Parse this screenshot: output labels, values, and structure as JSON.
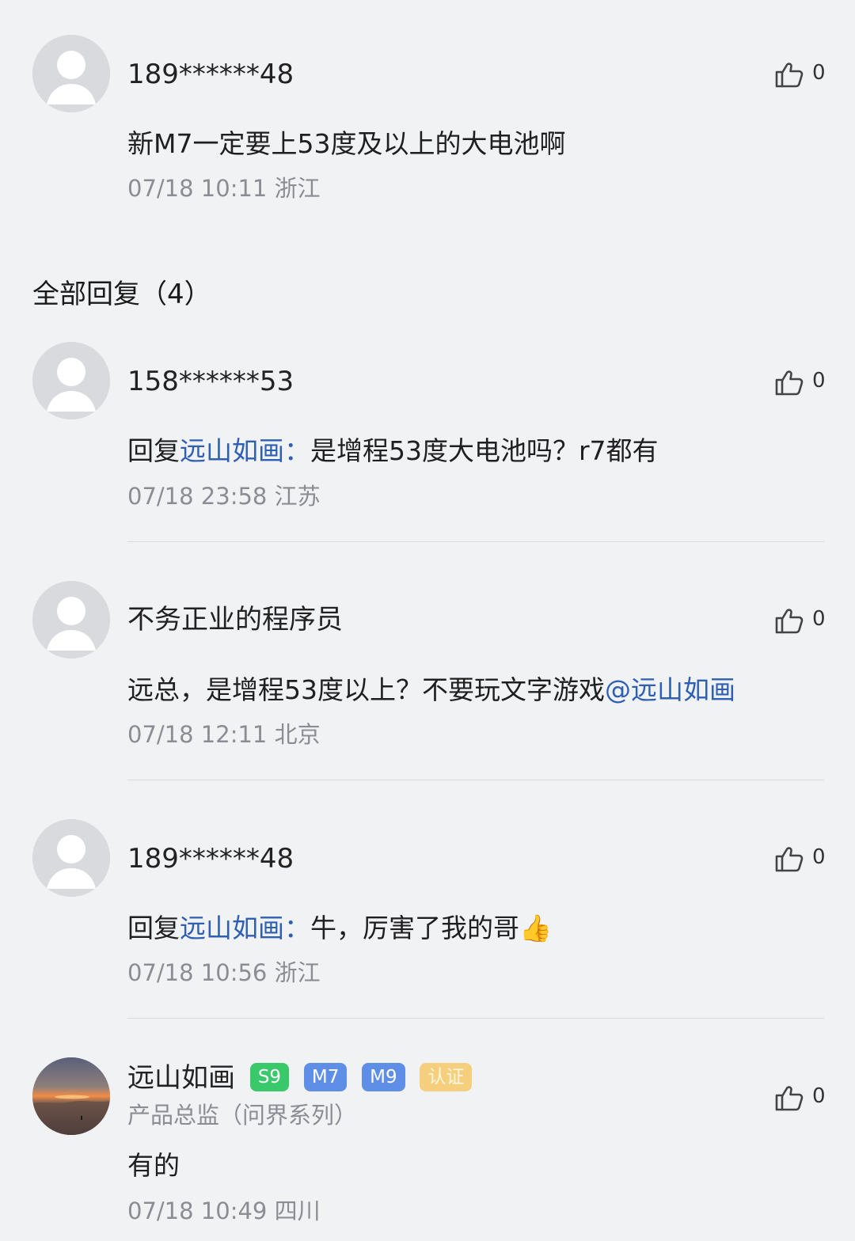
{
  "main_comment": {
    "user": "189******48",
    "likes": "0",
    "text": "新M7一定要上53度及以上的大电池啊",
    "time": "07/18 10:11",
    "location": "浙江"
  },
  "section": {
    "title": "全部回复（4）"
  },
  "replies": [
    {
      "user": "158******53",
      "likes": "0",
      "prefix": "回复",
      "mention": "远山如画：",
      "text": "是增程53度大电池吗？r7都有",
      "time": "07/18 23:58",
      "location": "江苏"
    },
    {
      "user": "不务正业的程序员",
      "likes": "0",
      "text": "远总，是增程53度以上？不要玩文字游戏",
      "mention": "@远山如画",
      "time": "07/18 12:11",
      "location": "北京"
    },
    {
      "user": "189******48",
      "likes": "0",
      "prefix": "回复",
      "mention": "远山如画：",
      "text": "牛，厉害了我的哥👍",
      "time": "07/18 10:56",
      "location": "浙江"
    },
    {
      "user": "远山如画",
      "likes": "0",
      "badges": [
        "S9",
        "M7",
        "M9",
        "认证"
      ],
      "subtitle": "产品总监（问界系列）",
      "text": "有的",
      "time": "07/18 10:49",
      "location": "四川"
    }
  ],
  "icons": {
    "avatar": "avatar-icon",
    "like": "thumbs-up-icon"
  },
  "colors": {
    "background": "#f1f2f4",
    "link": "#2f5fb3",
    "meta": "#8a8d93",
    "badge_s9": "#39c86a",
    "badge_model": "#5f8ee7",
    "badge_cert": "#f5cf7d"
  }
}
